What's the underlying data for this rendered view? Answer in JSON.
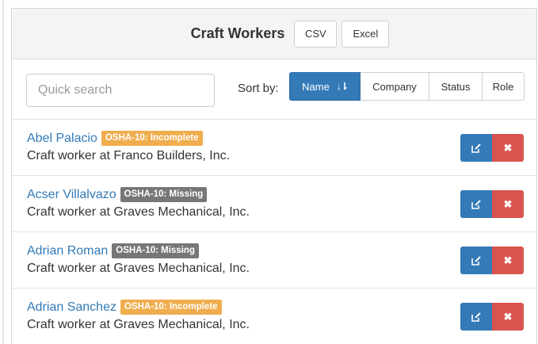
{
  "panel": {
    "title": "Craft Workers",
    "csv_label": "CSV",
    "excel_label": "Excel"
  },
  "toolbar": {
    "search_placeholder": "Quick search",
    "sort_label": "Sort by:",
    "sort_options": [
      {
        "label": "Name",
        "active": true,
        "icon": "sort-alpha-icon",
        "icon_glyph": "↓⇂"
      },
      {
        "label": "Company",
        "active": false
      },
      {
        "label": "Status",
        "active": false
      },
      {
        "label": "Role",
        "active": false
      }
    ]
  },
  "workers": [
    {
      "name": "Abel Palacio",
      "badge": "OSHA-10: Incomplete",
      "badge_status": "incomplete",
      "subtitle": "Craft worker at Franco Builders, Inc."
    },
    {
      "name": "Acser Villalvazo",
      "badge": "OSHA-10: Missing",
      "badge_status": "missing",
      "subtitle": "Craft worker at Graves Mechanical, Inc."
    },
    {
      "name": "Adrian Roman",
      "badge": "OSHA-10: Missing",
      "badge_status": "missing",
      "subtitle": "Craft worker at Graves Mechanical, Inc."
    },
    {
      "name": "Adrian Sanchez",
      "badge": "OSHA-10: Incomplete",
      "badge_status": "incomplete",
      "subtitle": "Craft worker at Graves Mechanical, Inc."
    }
  ],
  "actions": {
    "edit_icon": "edit-icon",
    "delete_icon": "close-icon",
    "delete_glyph": "✖"
  },
  "colors": {
    "primary": "#337ab7",
    "danger": "#d9534f",
    "warning": "#f0ad4e",
    "muted": "#777777"
  }
}
